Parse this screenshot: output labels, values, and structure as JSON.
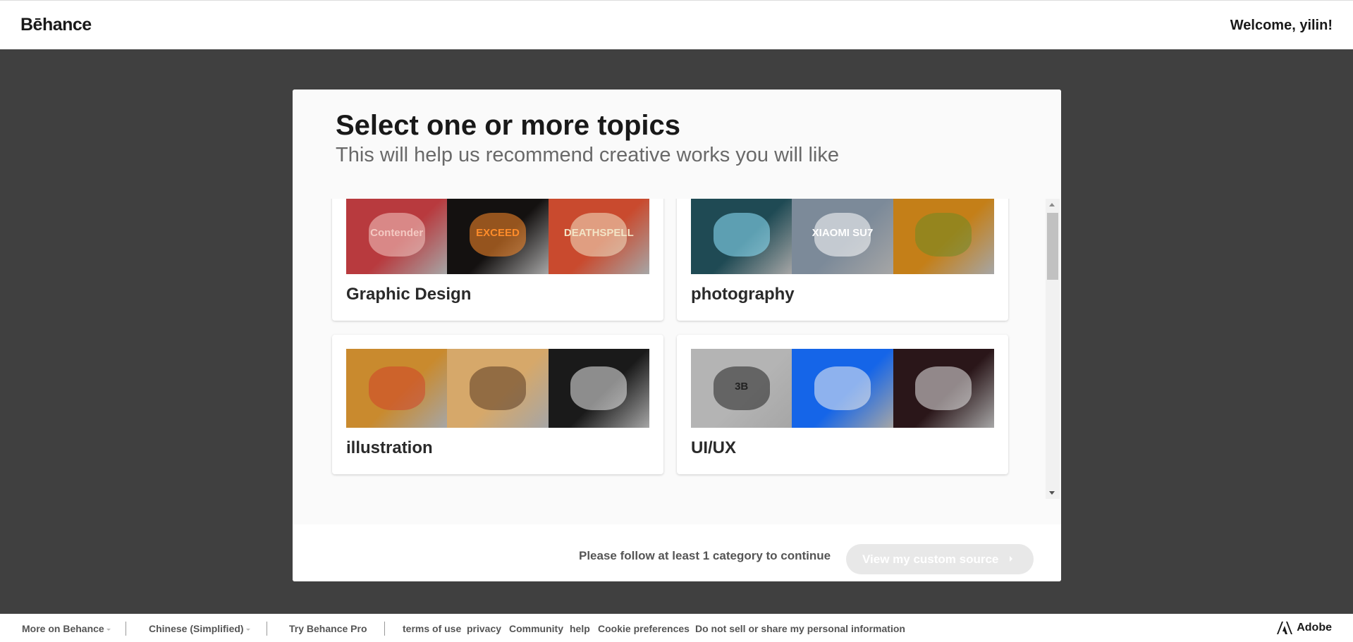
{
  "header": {
    "logo": "Bēhance",
    "welcome": "Welcome, yilin!"
  },
  "modal": {
    "title": "Select one or more topics",
    "subtitle": "This will help us recommend creative works you will like",
    "topics": [
      {
        "label": "Graphic Design",
        "thumbs": [
          {
            "text": "Contender",
            "bg": "#b83a3e",
            "fg": "#f4c9c2"
          },
          {
            "text": "EXCEED",
            "bg": "#141110",
            "fg": "#ff8c2a"
          },
          {
            "text": "DEATHSPELL",
            "bg": "#c94a2e",
            "fg": "#f3e4c6"
          }
        ]
      },
      {
        "label": "photography",
        "thumbs": [
          {
            "text": "",
            "bg": "#1f4a54",
            "fg": "#8fe6ff"
          },
          {
            "text": "XIAOMI SU7",
            "bg": "#7c8a99",
            "fg": "#ffffff"
          },
          {
            "text": "",
            "bg": "#c47f18",
            "fg": "#6f8a24"
          }
        ]
      },
      {
        "label": "illustration",
        "thumbs": [
          {
            "text": "",
            "bg": "#c98a2e",
            "fg": "#d0432a"
          },
          {
            "text": "",
            "bg": "#d6a86a",
            "fg": "#5b3a23"
          },
          {
            "text": "",
            "bg": "#1a1a1a",
            "fg": "#ececec"
          }
        ]
      },
      {
        "label": "UI/UX",
        "thumbs": [
          {
            "text": "3B",
            "bg": "#b4b4b4",
            "fg": "#222222"
          },
          {
            "text": "",
            "bg": "#1565e8",
            "fg": "#f3f3f3"
          },
          {
            "text": "",
            "bg": "#2a1619",
            "fg": "#e7e7e7"
          }
        ]
      }
    ],
    "follow_note": "Please follow at least 1 category to continue",
    "cta_label": "View my custom source"
  },
  "footer": {
    "more": "More on Behance",
    "language": "Chinese (Simplified)",
    "pro": "Try Behance Pro",
    "links": [
      "terms of use",
      "privacy",
      "Community",
      "help",
      "Cookie preferences",
      "Do not sell or share my personal information"
    ],
    "adobe": "Adobe"
  },
  "colors": {
    "overlay": "#404040",
    "accent": "#191919",
    "cta_disabled": "#e8e8e8"
  }
}
